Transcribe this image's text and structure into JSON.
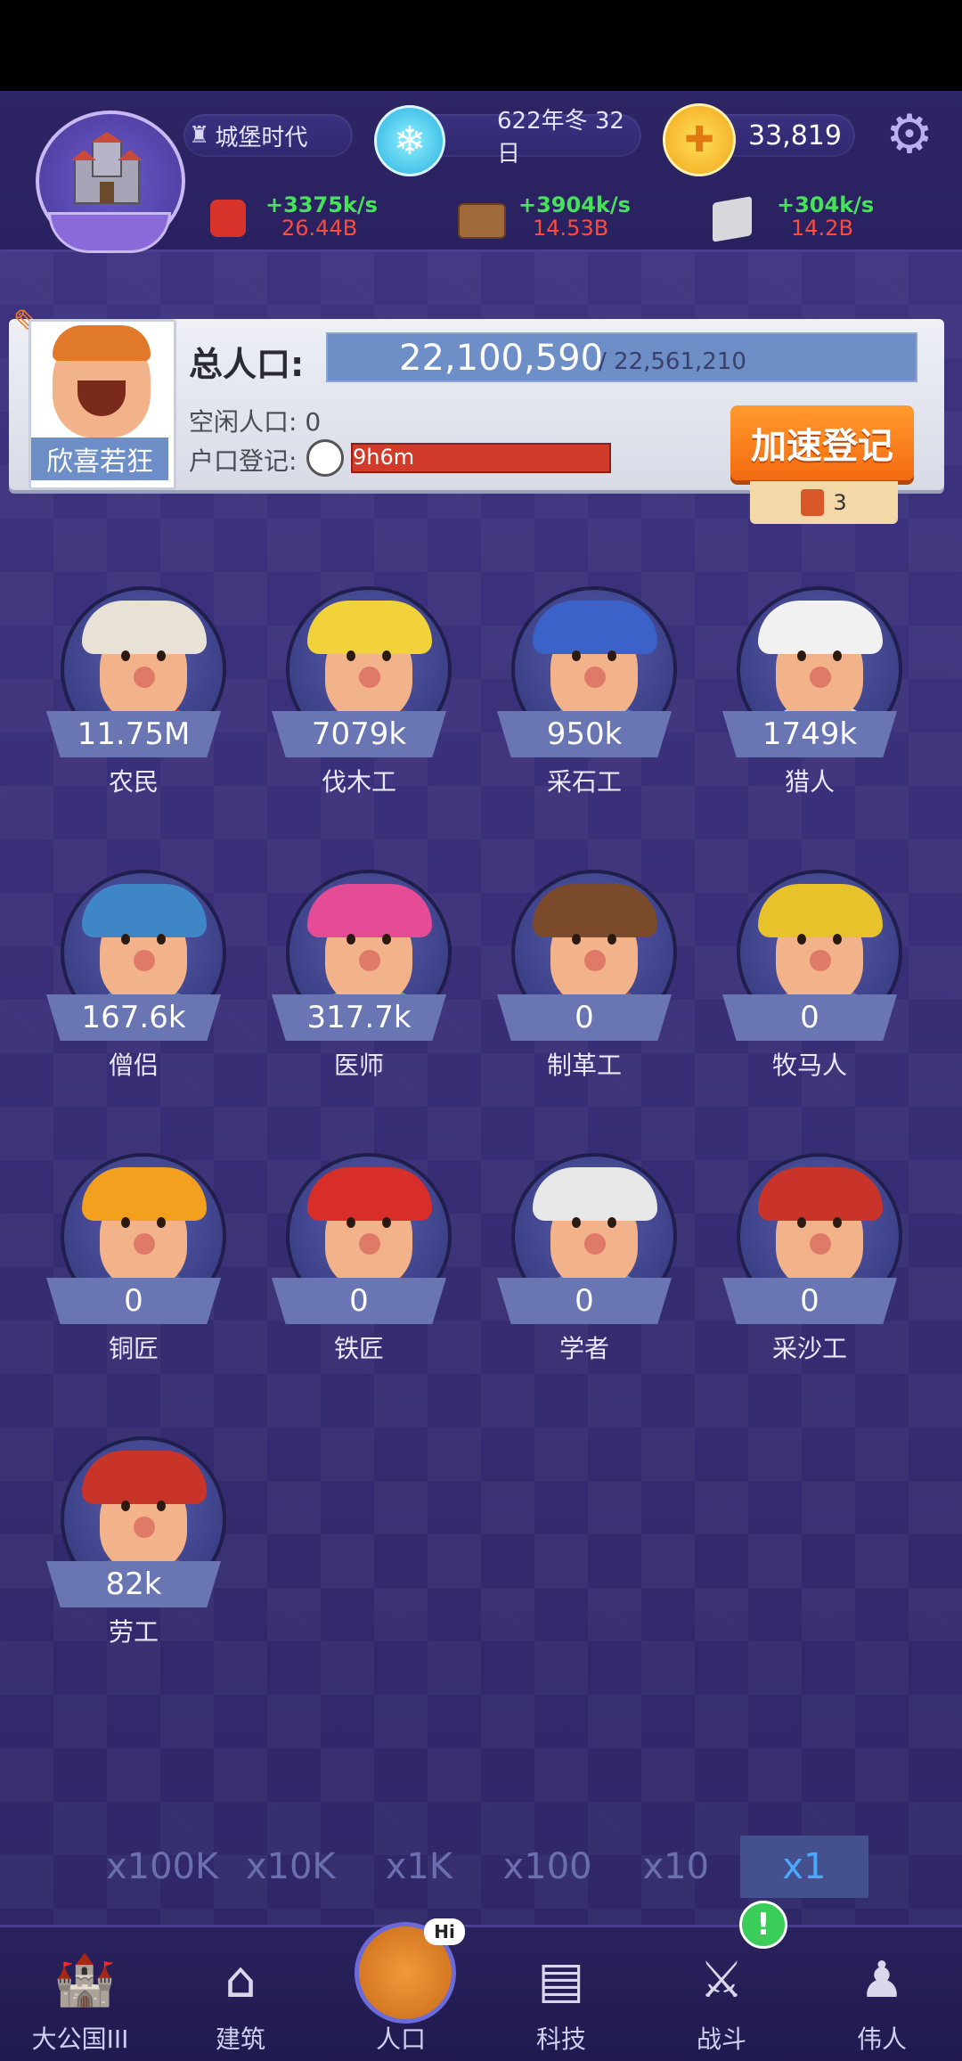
{
  "header": {
    "era": "城堡时代",
    "date": "622年冬 32日",
    "coins": "33,819",
    "resources": [
      {
        "icon": "apple-icon",
        "rate": "+3375k/s",
        "total": "26.44B"
      },
      {
        "icon": "wood-icon",
        "rate": "+3904k/s",
        "total": "14.53B"
      },
      {
        "icon": "stone-icon",
        "rate": "+304k/s",
        "total": "14.2B"
      }
    ]
  },
  "population": {
    "mood": "欣喜若狂",
    "total_label": "总人口:",
    "current": "22,100,590",
    "capacity": "/ 22,561,210",
    "fill_fraction": 0.98,
    "idle_label": "空闲人口: 0",
    "register_label": "户口登记:",
    "register_time": "9h6m",
    "speed_button": "加速登记",
    "ticket_count": "3"
  },
  "workers": [
    {
      "name": "农民",
      "count": "11.75M",
      "hair": "#e8e2d6",
      "shirt": "#d8332a"
    },
    {
      "name": "伐木工",
      "count": "7079k",
      "hair": "#f2d23a",
      "shirt": "#8a4a22"
    },
    {
      "name": "采石工",
      "count": "950k",
      "hair": "#3a62c8",
      "shirt": "#3a78d8"
    },
    {
      "name": "猎人",
      "count": "1749k",
      "hair": "#f1f1f1",
      "shirt": "#e8e0d2"
    },
    {
      "name": "僧侣",
      "count": "167.6k",
      "hair": "#3f86c6",
      "shirt": "#3f86c6"
    },
    {
      "name": "医师",
      "count": "317.7k",
      "hair": "#e64c96",
      "shirt": "#56b54a"
    },
    {
      "name": "制革工",
      "count": "0",
      "hair": "#7a4a2a",
      "shirt": "#d24030"
    },
    {
      "name": "牧马人",
      "count": "0",
      "hair": "#e8c22a",
      "shirt": "#8a5aa8"
    },
    {
      "name": "铜匠",
      "count": "0",
      "hair": "#f2a01e",
      "shirt": "#4a6aa8"
    },
    {
      "name": "铁匠",
      "count": "0",
      "hair": "#d82e2a",
      "shirt": "#6a4a3a"
    },
    {
      "name": "学者",
      "count": "0",
      "hair": "#e8e8e8",
      "shirt": "#5a8ad8"
    },
    {
      "name": "采沙工",
      "count": "0",
      "hair": "#c8342a",
      "shirt": "#6a5a4a"
    },
    {
      "name": "劳工",
      "count": "82k",
      "hair": "#c8342a",
      "shirt": "#8a5a3a"
    }
  ],
  "multipliers": [
    "x100K",
    "x10K",
    "x1K",
    "x100",
    "x10",
    "x1"
  ],
  "selected_multiplier": "x1",
  "nav": [
    {
      "label": "大公国III",
      "icon": "castle-icon"
    },
    {
      "label": "建筑",
      "icon": "house-icon"
    },
    {
      "label": "人口",
      "icon": "population-icon",
      "badge": "Hi"
    },
    {
      "label": "科技",
      "icon": "book-icon"
    },
    {
      "label": "战斗",
      "icon": "swords-icon",
      "badge": "!"
    },
    {
      "label": "伟人",
      "icon": "bust-icon"
    }
  ]
}
